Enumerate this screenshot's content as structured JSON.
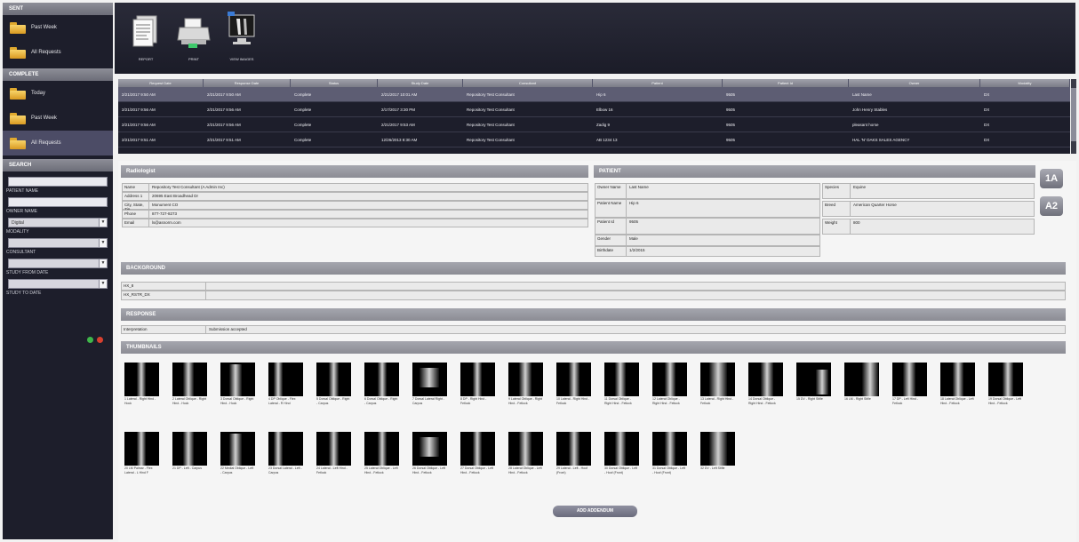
{
  "sidebar": {
    "sent_heading": "SENT",
    "sent_items": [
      {
        "label": "Past Week"
      },
      {
        "label": "All Requests"
      }
    ],
    "complete_heading": "COMPLETE",
    "complete_items": [
      {
        "label": "Today"
      },
      {
        "label": "Past Week"
      },
      {
        "label": "All Requests"
      }
    ],
    "search_heading": "SEARCH",
    "search": {
      "patient_name_label": "PATIENT NAME",
      "owner_name_label": "OWNER NAME",
      "modality_label": "MODALITY",
      "modality_value": "Digital",
      "consultant_label": "CONSULTANT",
      "study_from_date_label": "STUDY FROM DATE",
      "study_to_date_label": "STUDY TO DATE"
    }
  },
  "toolbar": {
    "tools": [
      {
        "label": "REPORT",
        "icon": "report-icon"
      },
      {
        "label": "PRINT",
        "icon": "printer-icon"
      },
      {
        "label": "VIEW IMAGES",
        "icon": "monitor-icon"
      }
    ]
  },
  "requests": {
    "columns": [
      "Request Date",
      "Response Date",
      "Status",
      "Study Date",
      "Consultant",
      "Patient",
      "Patient Id",
      "Owner",
      "Modality"
    ],
    "rows": [
      [
        "2/21/2017 9:50 AM",
        "2/21/2017 9:50 AM",
        "Complete",
        "2/21/2017 10:01 AM",
        "Repository Test Consultant",
        "Hip 6",
        "9505",
        "Last Name",
        "DX"
      ],
      [
        "2/21/2017 9:56 AM",
        "2/21/2017 9:56 AM",
        "Complete",
        "2/17/2017 3:30 PM",
        "Repository Test Consultant",
        "Elbow 16",
        "9505",
        "John Henry Stables",
        "DX"
      ],
      [
        "2/21/2017 9:56 AM",
        "2/21/2017 9:56 AM",
        "Complete",
        "2/21/2017 9:53 AM",
        "Repository Test Consultant",
        "Zadig 9",
        "9505",
        "pleasant horse",
        "DX"
      ],
      [
        "2/21/2017 9:51 AM",
        "2/21/2017 9:51 AM",
        "Complete",
        "12/26/2013 8:30 AM",
        "Repository Test Consultant",
        "AB 1234 13",
        "9505",
        "HAL 'N' OAKS SALES AGENCY",
        "DX"
      ]
    ]
  },
  "radiologist": {
    "heading": "Radiologist",
    "fields": [
      {
        "k": "Name",
        "v": "Repository Test Consultant (A Admin Inc)"
      },
      {
        "k": "Address 1",
        "v": "20695 East Broadhead Dr"
      },
      {
        "k": "City, State, Zip",
        "v": "Monument CO"
      },
      {
        "k": "Phone",
        "v": "877-727-8273"
      },
      {
        "k": "Email",
        "v": "ls@asnorm.com"
      }
    ]
  },
  "patient": {
    "heading": "PATIENT",
    "left_fields": [
      {
        "k": "Owner Name",
        "v": "Last Name"
      },
      {
        "k": "Patient Name",
        "v": "Hip 6"
      },
      {
        "k": "Patient Id",
        "v": "9505"
      },
      {
        "k": "Gender",
        "v": "Male"
      },
      {
        "k": "Birthdate",
        "v": "1/2/2015"
      }
    ],
    "right_fields": [
      {
        "k": "Species",
        "v": "Equine"
      },
      {
        "k": "Breed",
        "v": "American Quarter Horse"
      },
      {
        "k": "Weight",
        "v": "800"
      }
    ],
    "buttons": [
      {
        "label": "1A",
        "icon": "language-icon"
      },
      {
        "label": "A2",
        "icon": "font-size-icon"
      }
    ]
  },
  "background": {
    "heading": "BACKGROUND",
    "fields": [
      {
        "k": "HX_8",
        "v": ""
      },
      {
        "k": "HX_RSTR_DX",
        "v": ""
      }
    ]
  },
  "response": {
    "heading": "RESPONSE",
    "fields": [
      {
        "k": "Interpretation",
        "v": "Submission accepted"
      }
    ]
  },
  "thumbnails": {
    "heading": "THUMBNAILS",
    "row1": [
      "1 Lateral - Right Hind - Hock",
      "2 Lateral Oblique - Right Hind - Hock",
      "3 Dorsal Oblique - Right Hind - Hock",
      "4 DP Oblique - Flex Lateral - R Hind",
      "5 Dorsal Oblique - Right - Carpus",
      "6 Dorsal Oblique - Right - Carpus",
      "7 Dorsal Lateral Right - Carpus",
      "8 DP - Right Hind - Fetlock",
      "9 Lateral Oblique - Right Hind - Fetlock",
      "10 Lateral - Right Hind - Fetlock",
      "11 Dorsal Oblique - Right Hind - Fetlock",
      "12 Lateral Oblique - Right Hind - Fetlock",
      "13 Lateral - Right Hind - Fetlock",
      "14 Dorsal Oblique - Right Hind - Fetlock",
      "15 DV - Right Stifle",
      "16 LM - Right Stifle",
      "17 DP - Left Hind - Fetlock",
      "18 Lateral Oblique - Left Hind - Fetlock",
      "19 Dorsal Oblique - Left Hind - Fetlock"
    ],
    "row2": [
      "20 LM Palmar - Flex Lateral - L Hind F",
      "21 DP - Left - Carpus",
      "22 Medial Oblique - Left - Carpus",
      "23 Dorsal Lateral - Left - Carpus",
      "24 Lateral - Left Hind - Fetlock",
      "25 Lateral Oblique - Left Hind - Fetlock",
      "26 Dorsal Oblique - Left Hind - Fetlock",
      "27 Dorsal Oblique - Left Hind - Fetlock",
      "28 Lateral Oblique - Left Hind - Fetlock",
      "29 Lateral - Left - Hoof (Front)",
      "30 Dorsal Oblique - Left - Hoof (Front)",
      "31 Dorsal Oblique - Left - Hoof (Front)",
      "32 DV - Left Stifle"
    ]
  },
  "footer": {
    "add_addendum_label": "ADD ADDENDUM"
  },
  "colors": {
    "sidebar_bg": "#1d1e2b",
    "panel_head": "#9a9ba4",
    "selected_row": "#5d5d73",
    "accent_folder": "#e8b43c"
  }
}
